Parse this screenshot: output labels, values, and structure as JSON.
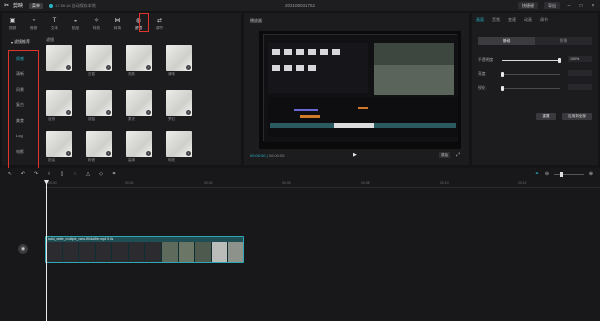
{
  "titlebar": {
    "app_name": "剪映",
    "menu": "菜单",
    "autosave": "17:59:16 自动保存本地",
    "doc_title": "202106031752",
    "shortcut": "快捷键",
    "export": "导出"
  },
  "toolbar": {
    "items": [
      {
        "label": "视频",
        "icon": "video-icon"
      },
      {
        "label": "音频",
        "icon": "audio-icon"
      },
      {
        "label": "文本",
        "icon": "text-icon"
      },
      {
        "label": "贴纸",
        "icon": "sticker-icon"
      },
      {
        "label": "特效",
        "icon": "effects-icon"
      },
      {
        "label": "转场",
        "icon": "transition-icon"
      },
      {
        "label": "滤镜",
        "icon": "filter-icon"
      },
      {
        "label": "调节",
        "icon": "adjust-icon"
      }
    ]
  },
  "media": {
    "header": "滤镜",
    "category_root": "滤镜推荐",
    "categories": [
      "质感",
      "清新",
      "风景",
      "复古",
      "美食",
      "Log",
      "电影"
    ],
    "active_category": "质感",
    "thumbs": [
      {
        "name": ""
      },
      {
        "name": "白皙"
      },
      {
        "name": "亮肤"
      },
      {
        "name": "清晰"
      },
      {
        "name": "自然"
      },
      {
        "name": "孤独"
      },
      {
        "name": "柔光"
      },
      {
        "name": "梦幻"
      },
      {
        "name": "奶油"
      },
      {
        "name": "粉瓷"
      },
      {
        "name": "高清"
      },
      {
        "name": "明亮"
      },
      {
        "name": ""
      }
    ]
  },
  "player": {
    "title": "播放器",
    "current_time": "00:00:00",
    "total_time": "00:00:05",
    "ratio": "原始"
  },
  "properties": {
    "tabs": [
      "画面",
      "音频",
      "变速",
      "动画",
      "调节"
    ],
    "active_tab": "画面",
    "segments": [
      "基础",
      "抠像"
    ],
    "active_segment": "基础",
    "opacity_label": "不透明度",
    "opacity_value": "100%",
    "opacity_level": 1.0,
    "brightness_label": "亮度",
    "contrast_label": "锐化",
    "reset_button": "重置",
    "apply_all_button": "应用到全部"
  },
  "timeline": {
    "ticks": [
      "00:00",
      "00:02",
      "00:04",
      "00:06",
      "00:08",
      "00:10",
      "00:12"
    ],
    "clip_label": "solid_white_multiple_vans.f4h4a0hh.mp4   5.0s"
  },
  "colors": {
    "accent": "#29b5c4",
    "highlight": "#e0342e",
    "clip": "#1f4f55"
  }
}
